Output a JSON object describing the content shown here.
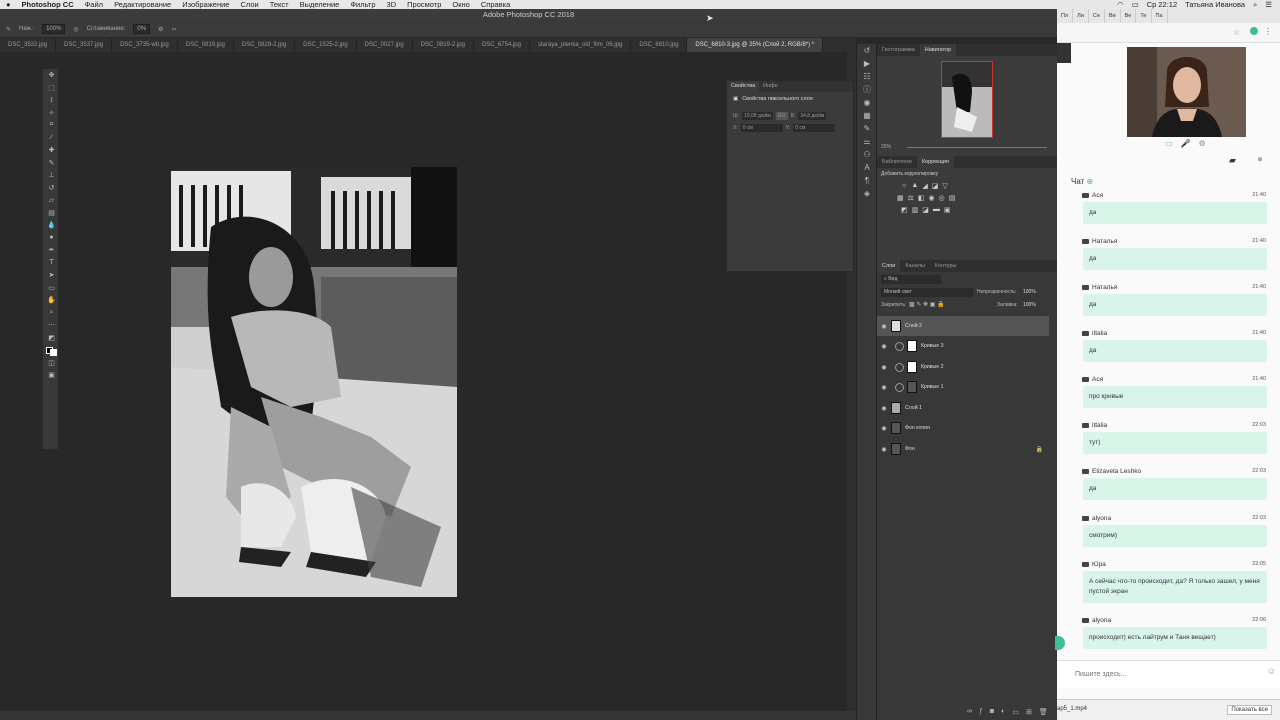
{
  "mac_menu": {
    "app_name": "Photoshop CC",
    "items": [
      "Файл",
      "Редактирование",
      "Изображение",
      "Слои",
      "Текст",
      "Выделение",
      "Фильтр",
      "3D",
      "Просмотр",
      "Окно",
      "Справка"
    ],
    "clock": "Ср 22:12",
    "user": "Татьяна Иванова"
  },
  "window_title": "Adobe Photoshop CC 2018",
  "options": {
    "opacity_label": "Наж.:",
    "opacity_value": "100%",
    "smoothing_label": "Сглаживание:",
    "smoothing_value": "0%"
  },
  "doc_tabs": [
    "DSC_3532.jpg",
    "DSC_3537.jpg",
    "DSC_3735-wb.jpg",
    "DSC_0819.jpg",
    "DSC_0829-2.jpg",
    "DSC_1525-2.jpg",
    "DSC_0027.jpg",
    "DSC_0819-2.jpg",
    "DSC_6754.jpg",
    "staraya_plenka_old_film_06.jpg",
    "DSC_6810.jpg",
    "DSC_6810-3.jpg @ 25% (Слой 2, RGB/8*) *"
  ],
  "properties": {
    "tabs": [
      "Свойства",
      "Инфо"
    ],
    "title": "Свойства пиксельного слоя",
    "w_label": "Ш:",
    "w_value": "19,08 дюйм",
    "link": "GO",
    "h_label": "В:",
    "h_value": "34,8 дюйм",
    "x_label": "X:",
    "x_value": "0 см",
    "y_label": "Y:",
    "y_value": "0 см"
  },
  "navigator": {
    "tabs": [
      "Гистограмма",
      "Навигатор"
    ],
    "zoom": "25%"
  },
  "adjustments": {
    "tabs": [
      "Библиотеки",
      "Коррекция"
    ],
    "add_label": "Добавить корректировку"
  },
  "layers": {
    "tabs": [
      "Слои",
      "Каналы",
      "Контуры"
    ],
    "filter": "Вид",
    "blend_mode": "Мягкий свет",
    "opacity_label": "Непрозрачность:",
    "opacity_value": "100%",
    "lock_label": "Закрепить:",
    "fill_label": "Заливка:",
    "fill_value": "100%",
    "items": [
      {
        "name": "Слой 2",
        "kind": "pixel"
      },
      {
        "name": "Кривые 3",
        "kind": "adj"
      },
      {
        "name": "Кривые 2",
        "kind": "adj"
      },
      {
        "name": "Кривые 1",
        "kind": "adj"
      },
      {
        "name": "Слой 1",
        "kind": "pixel"
      },
      {
        "name": "Фон копия",
        "kind": "photo"
      },
      {
        "name": "Фон",
        "kind": "photo"
      }
    ]
  },
  "chat": {
    "browser_tabs": [
      "Пл",
      "Ли",
      "Се",
      "Ви",
      "Ве",
      "Те",
      "Па"
    ],
    "title": "Чат",
    "placeholder": "Пишите здесь...",
    "download_file": "ар5_1.mp4",
    "show_all": "Показать все",
    "messages": [
      {
        "user": "Ася",
        "time": "21:40",
        "text": "да"
      },
      {
        "user": "Наталья",
        "time": "21:40",
        "text": "да"
      },
      {
        "user": "Наталья",
        "time": "21:40",
        "text": "да"
      },
      {
        "user": "ittalia",
        "time": "21:40",
        "text": "да"
      },
      {
        "user": "Ася",
        "time": "21:40",
        "text": "про кривые"
      },
      {
        "user": "ittalia",
        "time": "22:03",
        "text": "тут)"
      },
      {
        "user": "Elizaveta Leshko",
        "time": "22:03",
        "text": "да"
      },
      {
        "user": "alyona",
        "time": "22:03",
        "text": "смотрим)"
      },
      {
        "user": "Юра",
        "time": "22:05",
        "text": "А сейчас что-то происходит, да? Я только зашел, у меня пустой экран"
      },
      {
        "user": "alyona",
        "time": "22:06",
        "text": "происходит) есть лайтрум и Таня вещает)"
      }
    ]
  },
  "colors": {
    "ps_bg": "#282828",
    "panel": "#3b3b3b",
    "chat_bubble": "#d9f5ea",
    "accent_green": "#3fbf8f"
  }
}
